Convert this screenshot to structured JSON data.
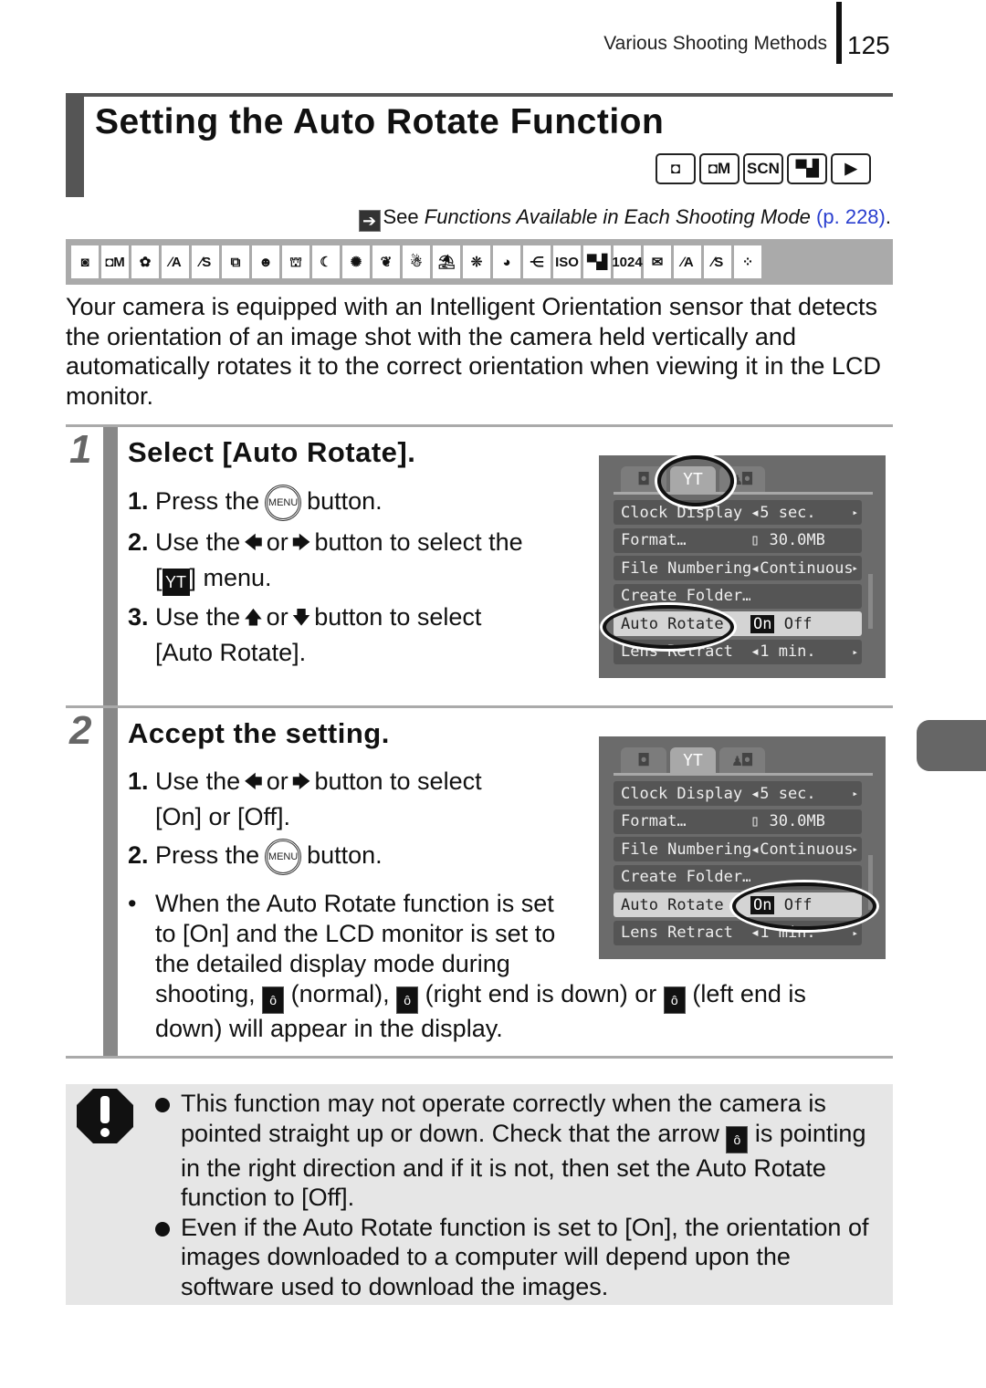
{
  "header": {
    "section": "Various Shooting Methods",
    "page_number": "125"
  },
  "title": "Setting the Auto Rotate Function",
  "mode_icons": [
    {
      "name": "auto-mode-icon",
      "glyph": "◘"
    },
    {
      "name": "manual-mode-icon",
      "glyph": "◘M"
    },
    {
      "name": "scene-mode-icon",
      "glyph": "SCN"
    },
    {
      "name": "movie-mode-icon",
      "glyph": "▀▟"
    },
    {
      "name": "playback-mode-icon",
      "glyph": "▶"
    }
  ],
  "see_also": {
    "prefix": "See ",
    "italic": "Functions Available in Each Shooting Mode",
    "link": "(p. 228)",
    "suffix": "."
  },
  "scene_icons": [
    {
      "name": "auto-icon",
      "glyph": "◙"
    },
    {
      "name": "manual-icon",
      "glyph": "◘M"
    },
    {
      "name": "digital-macro-icon",
      "glyph": "✿"
    },
    {
      "name": "color-accent-icon",
      "glyph": "∕A"
    },
    {
      "name": "color-swap-icon",
      "glyph": "∕S"
    },
    {
      "name": "stitch-assist-icon",
      "glyph": "⧉"
    },
    {
      "name": "portrait-icon",
      "glyph": "☻"
    },
    {
      "name": "landscape-icon",
      "glyph": "⛫"
    },
    {
      "name": "night-snapshot-icon",
      "glyph": "☾"
    },
    {
      "name": "party-icon",
      "glyph": "✺"
    },
    {
      "name": "foliage-icon",
      "glyph": "❦"
    },
    {
      "name": "snow-icon",
      "glyph": "☃"
    },
    {
      "name": "beach-icon",
      "glyph": "⛱"
    },
    {
      "name": "fireworks-icon",
      "glyph": "❊"
    },
    {
      "name": "aquarium-icon",
      "glyph": "◕"
    },
    {
      "name": "underwater-icon",
      "glyph": "⋲"
    },
    {
      "name": "iso3200-icon",
      "glyph": "ISO"
    },
    {
      "name": "movie-standard-icon",
      "glyph": "▀▟"
    },
    {
      "name": "movie-1024-icon",
      "glyph": "1024"
    },
    {
      "name": "movie-email-icon",
      "glyph": "✉"
    },
    {
      "name": "movie-color-accent-icon",
      "glyph": "∕A"
    },
    {
      "name": "movie-color-swap-icon",
      "glyph": "∕S"
    },
    {
      "name": "movie-time-lapse-icon",
      "glyph": "⁘"
    }
  ],
  "intro": "Your camera is equipped with an Intelligent Orientation sensor that detects the orientation of an image shot with the camera held vertically and automatically rotates it to the correct orientation when viewing it in the LCD monitor.",
  "steps": [
    {
      "number": "1",
      "title": "Select [Auto Rotate].",
      "substeps": [
        {
          "num": "1.",
          "a": "Press the",
          "btn": "MENU",
          "b": "button."
        },
        {
          "num": "2.",
          "a": "Use the",
          "arr1": "🡄",
          "or": "or",
          "arr2": "🡆",
          "b": "button to select the",
          "c_pre": "[",
          "icon": "ΥT",
          "c_post": "] menu."
        },
        {
          "num": "3.",
          "a": "Use the",
          "arr1": "🡅",
          "or": "or",
          "arr2": "🡇",
          "b": "button to select",
          "c": "[Auto Rotate]."
        }
      ]
    },
    {
      "number": "2",
      "title": "Accept the setting.",
      "substeps": [
        {
          "num": "1.",
          "a": "Use the",
          "arr1": "🡄",
          "or": "or",
          "arr2": "🡆",
          "b": "button to select",
          "c": "[On] or [Off]."
        },
        {
          "num": "2.",
          "a": "Press the",
          "btn": "MENU",
          "b": "button."
        }
      ],
      "note": {
        "bullet": "•",
        "l1": "When the Auto Rotate function is set",
        "l2": "to [On] and the LCD monitor is set to",
        "l3": "the detailed display mode during",
        "l4a": "shooting,",
        "normal": "(normal),",
        "right": "(right end is down) or",
        "left": "(left end is",
        "l5": "down) will appear in the display.",
        "orient_glyph": "ô"
      }
    }
  ],
  "lcd": {
    "tabs": [
      {
        "name": "camera-tab-icon",
        "glyph": "◘"
      },
      {
        "name": "setup-tab-icon",
        "glyph": "ΥT"
      },
      {
        "name": "my-camera-tab-icon",
        "glyph": "♟◘"
      }
    ],
    "rows": [
      {
        "label": "Clock Display",
        "value": "◂5 sec.",
        "chev": "▸"
      },
      {
        "label": "Format…",
        "value": "▯  30.0MB",
        "chev": ""
      },
      {
        "label": "File Numbering",
        "value": "◂Continuous",
        "chev": "▸"
      },
      {
        "label": "Create Folder…",
        "value": "",
        "chev": ""
      },
      {
        "label": "Auto Rotate",
        "value_on": "On",
        "value_off": "Off",
        "chev": ""
      },
      {
        "label": "Lens Retract",
        "value": "◂1 min.",
        "chev": "▸"
      }
    ]
  },
  "caution": {
    "icon": "!",
    "items": [
      {
        "a": "This function may not operate correctly when the camera is pointed straight up or down. Check that the arrow",
        "glyph": "ô",
        "b": "is pointing in the right direction and if it is not, then set the Auto Rotate function to [Off]."
      },
      {
        "a": "Even if the Auto Rotate function is set to [On], the orientation of images downloaded to a computer will depend upon the software used to download the images."
      }
    ]
  }
}
